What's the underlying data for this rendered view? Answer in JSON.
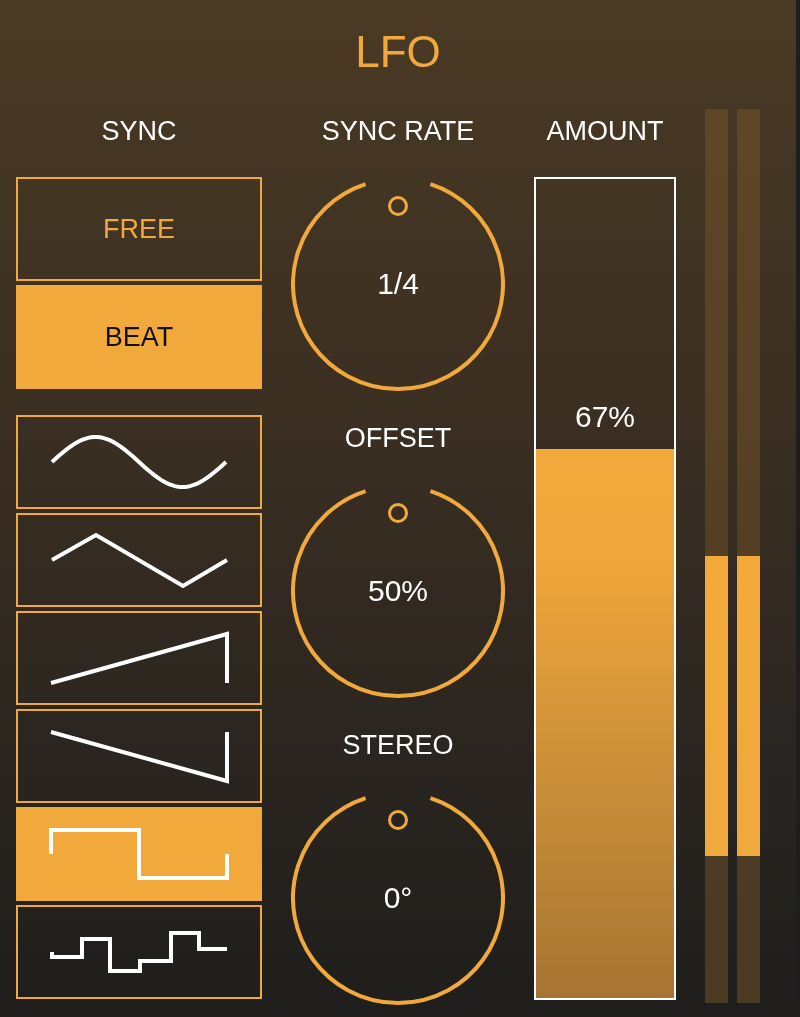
{
  "title": "LFO",
  "sync": {
    "label": "SYNC",
    "options": [
      {
        "label": "FREE",
        "selected": false
      },
      {
        "label": "BEAT",
        "selected": true
      }
    ]
  },
  "waveforms": [
    {
      "kind": "sine",
      "selected": false
    },
    {
      "kind": "triangle",
      "selected": false
    },
    {
      "kind": "rampup",
      "selected": false
    },
    {
      "kind": "rampdown",
      "selected": false
    },
    {
      "kind": "square",
      "selected": true
    },
    {
      "kind": "stepped",
      "selected": false
    }
  ],
  "knobs": [
    {
      "label": "SYNC RATE",
      "value": "1/4",
      "level": 0.5
    },
    {
      "label": "OFFSET",
      "value": "50%",
      "level": 0.5
    },
    {
      "label": "STEREO",
      "value": "0°",
      "level": 0.5
    }
  ],
  "amount": {
    "label": "AMOUNT",
    "value": "67%",
    "level": 0.67
  },
  "meters": [
    {
      "downward": true,
      "level": 0.336
    },
    {
      "downward": true,
      "level": 0.336
    }
  ]
}
